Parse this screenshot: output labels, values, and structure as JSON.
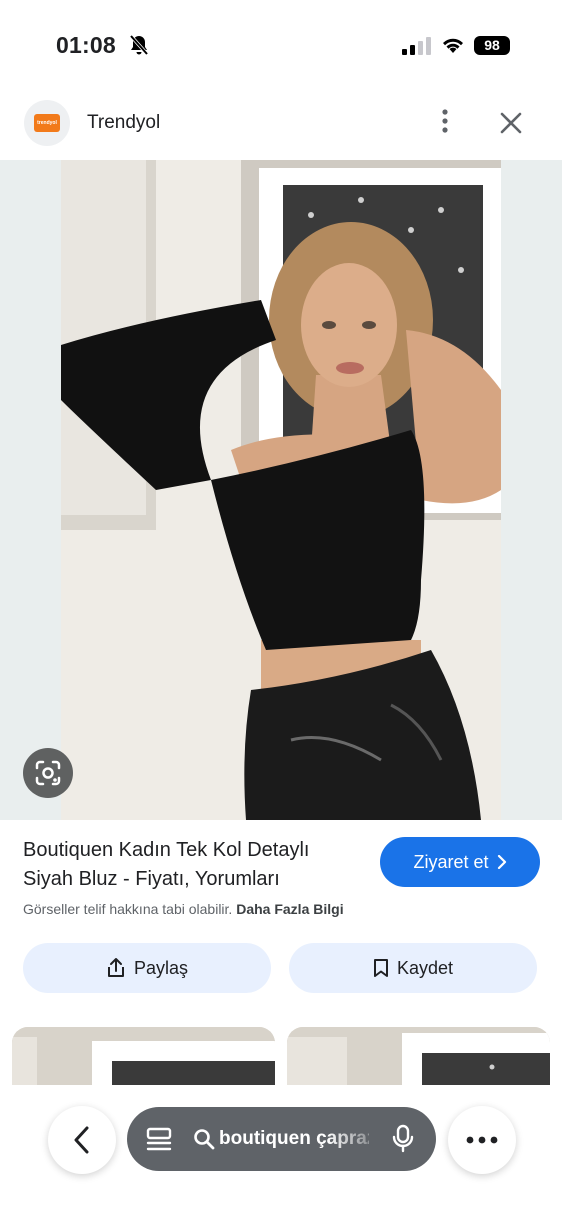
{
  "status": {
    "time": "01:08",
    "battery": "98",
    "icons": [
      "bell-slash-icon",
      "cellular-signal-icon",
      "wifi-icon",
      "battery-icon"
    ]
  },
  "header": {
    "logo_text": "trendyol",
    "site_name": "Trendyol",
    "icons": [
      "more-vert-icon",
      "close-icon"
    ]
  },
  "image": {
    "lens_icon": "google-lens-icon"
  },
  "result": {
    "title_line1": "Boutiquen Kadın Tek Kol Detaylı",
    "title_line2": "Siyah Bluz - Fiyatı, Yorumları",
    "visit_label": "Ziyaret et",
    "copyright_text": "Görseller telif hakkına tabi olabilir.",
    "more_info_label": "Daha Fazla Bilgi"
  },
  "actions": {
    "share_label": "Paylaş",
    "save_label": "Kaydet"
  },
  "bottom_bar": {
    "search_query": "boutiquen çapraz",
    "icons": [
      "back-icon",
      "tabs-icon",
      "search-icon",
      "mic-icon",
      "more-icon"
    ]
  },
  "colors": {
    "accent": "#1a73e8",
    "action_bg": "#e8f0fe",
    "brand": "#f27a1a"
  }
}
